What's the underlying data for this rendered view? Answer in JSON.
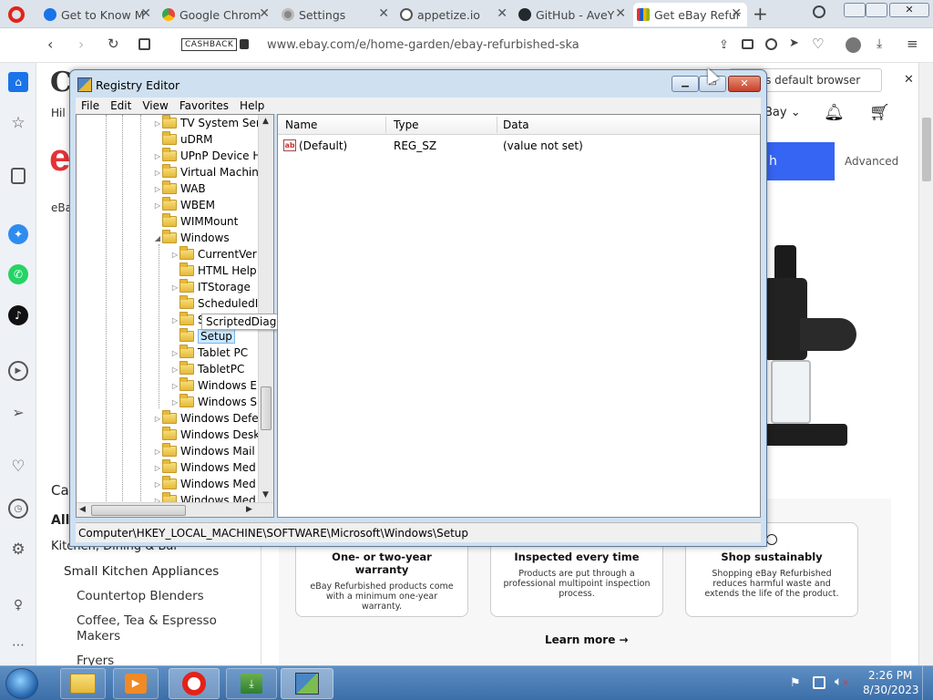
{
  "browser": {
    "tabs": [
      {
        "label": "Get to Know M",
        "color": "#1a73e8"
      },
      {
        "label": "Google Chrom",
        "color": "#e8453c"
      },
      {
        "label": "Settings",
        "color": "#888888"
      },
      {
        "label": "appetize.io",
        "color": "#555555"
      },
      {
        "label": "GitHub - AveY",
        "color": "#24292e"
      },
      {
        "label": "Get eBay Refur",
        "color": "#e53238"
      }
    ],
    "cashback": "CASHBACK",
    "url": "www.ebay.com/e/home-garden/ebay-refurbished-ska",
    "default_browser_prompt": "et it as default browser"
  },
  "ebay": {
    "top_left_text": "Hil",
    "ebay_label": "eBa",
    "search_button": "h",
    "advanced": "Advanced",
    "my_ebay": "Bay",
    "categories_heading": "Ca",
    "all": "All",
    "kitchen": "Kitchen, Dining & Bar",
    "small_kitchen": "Small Kitchen Appliances",
    "countertop": "Countertop Blenders",
    "coffee": "Coffee, Tea & Espresso Makers",
    "fryers": "Fryers",
    "cards": [
      {
        "title": "One- or two-year warranty",
        "body": "eBay Refurbished products come with a minimum one-year warranty."
      },
      {
        "title": "Inspected every time",
        "body": "Products are put through a professional multipoint inspection process."
      },
      {
        "title": "Shop sustainably",
        "body": "Shopping eBay Refurbished reduces harmful waste and extends the life of the product."
      }
    ],
    "learn_more": "Learn more →"
  },
  "registry": {
    "title": "Registry Editor",
    "menu": [
      "File",
      "Edit",
      "View",
      "Favorites",
      "Help"
    ],
    "tree": [
      {
        "label": "TV System Ser",
        "indent": 0,
        "expander": "▷"
      },
      {
        "label": "uDRM",
        "indent": 0,
        "expander": ""
      },
      {
        "label": "UPnP Device H",
        "indent": 0,
        "expander": "▷"
      },
      {
        "label": "Virtual Machin",
        "indent": 0,
        "expander": "▷"
      },
      {
        "label": "WAB",
        "indent": 0,
        "expander": "▷"
      },
      {
        "label": "WBEM",
        "indent": 0,
        "expander": "▷"
      },
      {
        "label": "WIMMount",
        "indent": 0,
        "expander": ""
      },
      {
        "label": "Windows",
        "indent": 0,
        "expander": "◢"
      },
      {
        "label": "CurrentVer",
        "indent": 1,
        "expander": "▷"
      },
      {
        "label": "HTML Help",
        "indent": 1,
        "expander": ""
      },
      {
        "label": "ITStorage",
        "indent": 1,
        "expander": "▷"
      },
      {
        "label": "ScheduledI",
        "indent": 1,
        "expander": ""
      },
      {
        "label": "ScriptedDi",
        "indent": 1,
        "expander": "▷"
      },
      {
        "label": "Setup",
        "indent": 1,
        "expander": ""
      },
      {
        "label": "Tablet PC",
        "indent": 1,
        "expander": "▷"
      },
      {
        "label": "TabletPC",
        "indent": 1,
        "expander": "▷"
      },
      {
        "label": "Windows E",
        "indent": 1,
        "expander": "▷"
      },
      {
        "label": "Windows S",
        "indent": 1,
        "expander": "▷"
      },
      {
        "label": "Windows Defe",
        "indent": 0,
        "expander": "▷"
      },
      {
        "label": "Windows Desk",
        "indent": 0,
        "expander": ""
      },
      {
        "label": "Windows Mail",
        "indent": 0,
        "expander": "▷"
      },
      {
        "label": "Windows Med",
        "indent": 0,
        "expander": "▷"
      },
      {
        "label": "Windows Med",
        "indent": 0,
        "expander": "▷"
      },
      {
        "label": "Windows Med",
        "indent": 0,
        "expander": "▷"
      }
    ],
    "tooltip": "ScriptedDiagnosticsProvider",
    "columns": [
      "Name",
      "Type",
      "Data"
    ],
    "rows": [
      {
        "name": "(Default)",
        "type": "REG_SZ",
        "data": "(value not set)"
      }
    ],
    "status_path": "Computer\\HKEY_LOCAL_MACHINE\\SOFTWARE\\Microsoft\\Windows\\Setup"
  },
  "taskbar": {
    "time": "2:26 PM",
    "date": "8/30/2023"
  }
}
